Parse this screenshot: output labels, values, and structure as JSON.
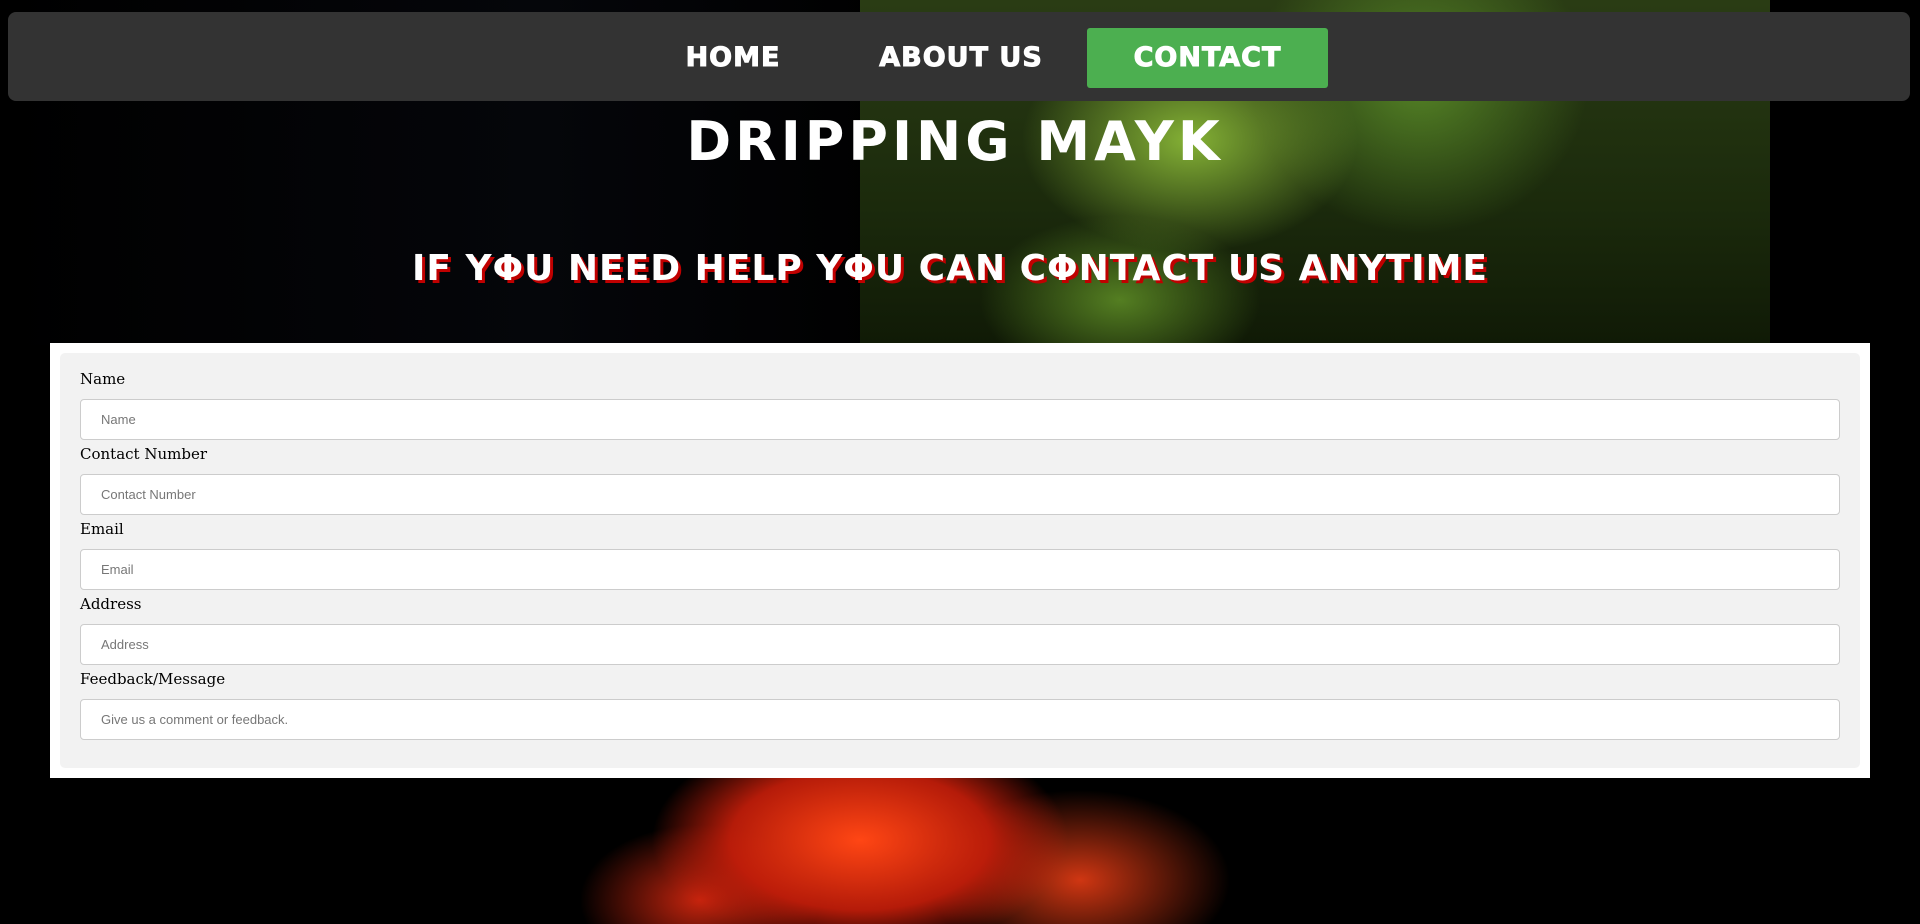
{
  "nav": {
    "items": [
      {
        "label": "HOME"
      },
      {
        "label": "ABOUT US"
      },
      {
        "label": "CONTACT",
        "active": true
      }
    ],
    "active_color": "#4caf50",
    "bar_color": "#333333"
  },
  "header": {
    "title": "DRIPPING MAYK",
    "subtitle": "IF YΦU NEED HELP YΦU CAN CΦNTACT US ANYTIME",
    "subtitle_shadow_color": "#c00000"
  },
  "form": {
    "fields": [
      {
        "label": "Name",
        "placeholder": "Name",
        "value": ""
      },
      {
        "label": "Contact Number",
        "placeholder": "Contact Number",
        "value": ""
      },
      {
        "label": "Email",
        "placeholder": "Email",
        "value": ""
      },
      {
        "label": "Address",
        "placeholder": "Address",
        "value": ""
      },
      {
        "label": "Feedback/Message",
        "placeholder": "Give us a comment or feedback.",
        "value": ""
      }
    ]
  }
}
